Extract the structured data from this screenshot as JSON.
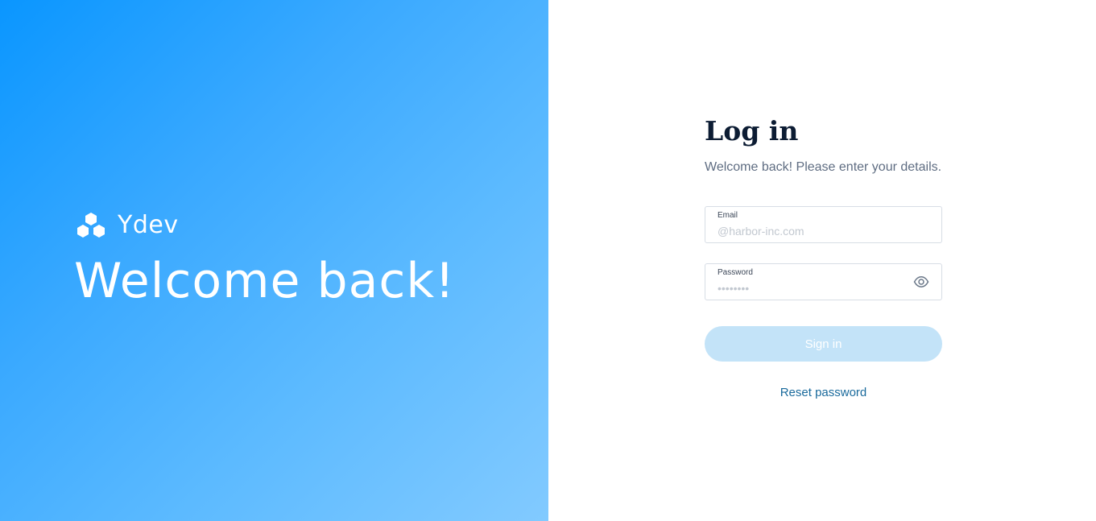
{
  "brand": {
    "name": "Ydev",
    "logo_icon": "three-cube-logo-icon"
  },
  "hero": {
    "title": "Welcome back!"
  },
  "login": {
    "title": "Log in",
    "subtitle": "Welcome back! Please enter your details.",
    "email": {
      "label": "Email",
      "placeholder": "@harbor-inc.com",
      "value": ""
    },
    "password": {
      "label": "Password",
      "placeholder": "••••••••",
      "value": "",
      "toggle_icon": "eye-icon"
    },
    "signin_label": "Sign in",
    "reset_label": "Reset password"
  },
  "colors": {
    "gradient_start": "#0a96ff",
    "gradient_end": "#82caff",
    "heading": "#0c1c33",
    "subtitle": "#5f6d82",
    "button_disabled_bg": "#c3e3f8",
    "link": "#1a6a9c"
  }
}
